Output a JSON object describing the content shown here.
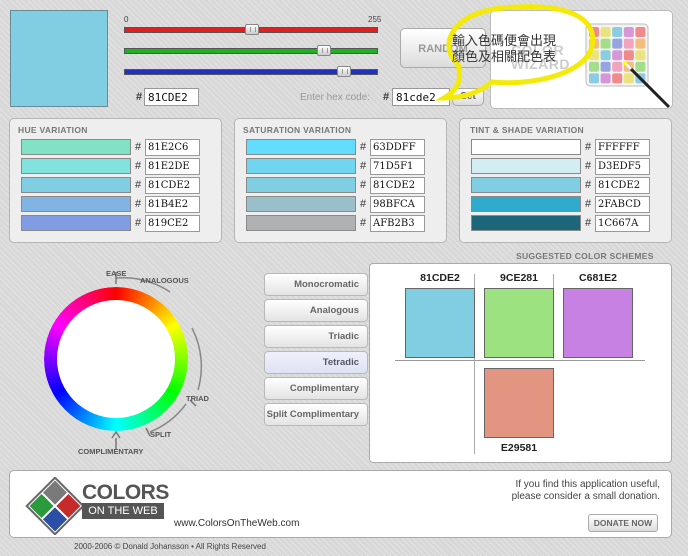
{
  "current": {
    "hex": "81CDE2",
    "hex_input": "81cde2",
    "color": "#81cde2",
    "rgb": [
      129,
      205,
      226
    ]
  },
  "sliders": {
    "min_label": "0",
    "max_label": "255",
    "channels": [
      {
        "name": "red",
        "color": "#e02020",
        "value": 129
      },
      {
        "name": "green",
        "color": "#20b020",
        "value": 205
      },
      {
        "name": "blue",
        "color": "#2030c0",
        "value": 226
      }
    ]
  },
  "hex_entry": {
    "label": "Enter hex code:",
    "hash": "#",
    "set_button": "Set"
  },
  "random_button": "RANDOM",
  "wizard_label": "COLOR WIZARD",
  "annotation": {
    "line1": "輸入色碼便會出現",
    "line2": "顏色及相關配色表"
  },
  "hue_variation": {
    "title": "HUE VARIATION",
    "items": [
      {
        "hex": "81E2C6",
        "color": "#81e2c6"
      },
      {
        "hex": "81E2DE",
        "color": "#81e2de"
      },
      {
        "hex": "81CDE2",
        "color": "#81cde2"
      },
      {
        "hex": "81B4E2",
        "color": "#81b4e2"
      },
      {
        "hex": "819CE2",
        "color": "#819ce2"
      }
    ]
  },
  "saturation_variation": {
    "title": "SATURATION VARIATION",
    "items": [
      {
        "hex": "63DDFF",
        "color": "#63ddff"
      },
      {
        "hex": "71D5F1",
        "color": "#71d5f1"
      },
      {
        "hex": "81CDE2",
        "color": "#81cde2"
      },
      {
        "hex": "98BFCA",
        "color": "#98bfca"
      },
      {
        "hex": "AFB2B3",
        "color": "#afb2b3"
      }
    ]
  },
  "tint_shade_variation": {
    "title": "TINT & SHADE VARIATION",
    "items": [
      {
        "hex": "FFFFFF",
        "color": "#ffffff"
      },
      {
        "hex": "D3EDF5",
        "color": "#d3edf5"
      },
      {
        "hex": "81CDE2",
        "color": "#81cde2"
      },
      {
        "hex": "2FABCD",
        "color": "#2fabcd"
      },
      {
        "hex": "1C667A",
        "color": "#1c667a"
      }
    ]
  },
  "wheel_labels": {
    "ease": "EASE",
    "analogous": "ANALOGOUS",
    "triad": "TRIAD",
    "split": "SPLIT",
    "complimentary": "COMPLIMENTARY"
  },
  "scheme_buttons": [
    {
      "label": "Monocromatic",
      "active": false
    },
    {
      "label": "Analogous",
      "active": false
    },
    {
      "label": "Triadic",
      "active": false
    },
    {
      "label": "Tetradic",
      "active": true
    },
    {
      "label": "Complimentary",
      "active": false
    },
    {
      "label": "Split Complimentary",
      "active": false
    }
  ],
  "suggested": {
    "title": "SUGGESTED COLOR SCHEMES",
    "colors": [
      {
        "hex": "81CDE2",
        "color": "#81cde2"
      },
      {
        "hex": "9CE281",
        "color": "#9ce281"
      },
      {
        "hex": "C681E2",
        "color": "#c681e2"
      },
      {
        "hex": "E29581",
        "color": "#e29581"
      }
    ]
  },
  "footer": {
    "logo_line1": "COLORS",
    "logo_line2": "ON THE WEB",
    "url": "www.ColorsOnTheWeb.com",
    "donate_text1": "If you find this application useful,",
    "donate_text2": "please consider a small donation.",
    "donate_button": "DONATE NOW",
    "copyright": "2000-2006 © Donald Johansson • All Rights Reserved"
  }
}
